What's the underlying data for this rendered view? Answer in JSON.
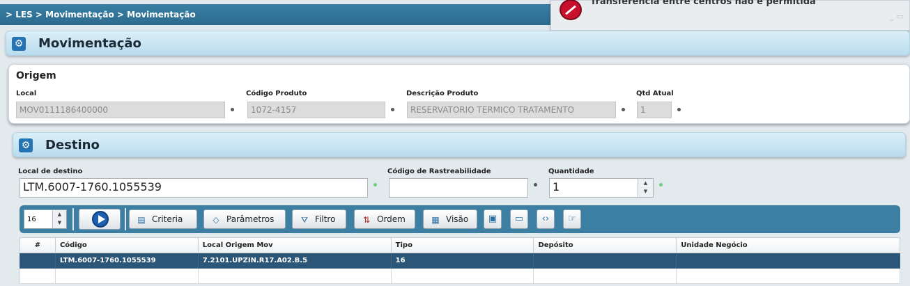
{
  "breadcrumb": "> LES > Movimentação > Movimentação",
  "notice": {
    "message": "Transferência entre centros não é permitida",
    "controls": "_ ▭"
  },
  "header": {
    "title": "Movimentação"
  },
  "origem": {
    "title": "Origem",
    "local_label": "Local",
    "local_value": "MOV0111186400000",
    "codigo_label": "Código Produto",
    "codigo_value": "1072-4157",
    "descricao_label": "Descrição Produto",
    "descricao_value": "RESERVATORIO TERMICO TRATAMENTO",
    "qtd_label": "Qtd Atual",
    "qtd_value": "1"
  },
  "destino": {
    "title": "Destino",
    "local_label": "Local de destino",
    "local_value": "LTM.6007-1760.1055539",
    "rastreab_label": "Código de Rastreabilidade",
    "rastreab_value": "",
    "quantidade_label": "Quantidade",
    "quantidade_value": "1"
  },
  "toolbar": {
    "page_size": "16",
    "criteria": "Criteria",
    "parametros": "Parâmetros",
    "filtro": "Filtro",
    "ordem": "Ordem",
    "visao": "Visão"
  },
  "grid": {
    "columns": [
      "#",
      "Código",
      "Local Origem Mov",
      "Tipo",
      "Depósito",
      "Unidade Negócio"
    ],
    "rows": [
      [
        "",
        "LTM.6007-1760.1055539",
        "7.2101.UPZIN.R17.A02.B.5",
        "16",
        "",
        ""
      ],
      [
        "",
        "",
        "",
        "",
        "",
        ""
      ]
    ]
  }
}
